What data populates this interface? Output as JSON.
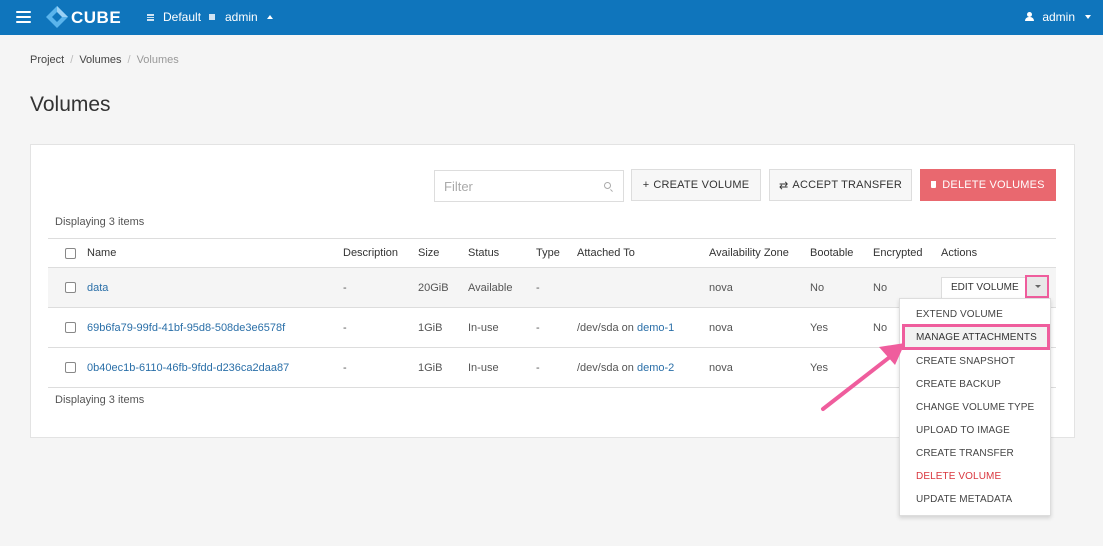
{
  "app": {
    "brand": "CUBE",
    "domain": "Default",
    "project": "admin",
    "user": "admin"
  },
  "breadcrumb": [
    "Project",
    "Volumes",
    "Volumes"
  ],
  "page_title": "Volumes",
  "toolbar": {
    "filter_placeholder": "Filter",
    "create_volume": "CREATE VOLUME",
    "accept_transfer": "ACCEPT TRANSFER",
    "delete_volumes": "DELETE VOLUMES"
  },
  "display_count": "Displaying 3 items",
  "table": {
    "headers": [
      "Name",
      "Description",
      "Size",
      "Status",
      "Type",
      "Attached To",
      "Availability Zone",
      "Bootable",
      "Encrypted",
      "Actions"
    ],
    "rows": [
      {
        "name": "data",
        "description": "-",
        "size": "20GiB",
        "status": "Available",
        "type": "-",
        "attached_path": "",
        "attached_on": "",
        "attached_instance": "",
        "zone": "nova",
        "bootable": "No",
        "encrypted": "No",
        "action": "EDIT VOLUME"
      },
      {
        "name": "69b6fa79-99fd-41bf-95d8-508de3e6578f",
        "description": "-",
        "size": "1GiB",
        "status": "In-use",
        "type": "-",
        "attached_path": "/dev/sda",
        "attached_on": "on",
        "attached_instance": "demo-1",
        "zone": "nova",
        "bootable": "Yes",
        "encrypted": "No",
        "action": ""
      },
      {
        "name": "0b40ec1b-6110-46fb-9fdd-d236ca2daa87",
        "description": "-",
        "size": "1GiB",
        "status": "In-use",
        "type": "-",
        "attached_path": "/dev/sda",
        "attached_on": "on",
        "attached_instance": "demo-2",
        "zone": "nova",
        "bootable": "Yes",
        "encrypted": "",
        "action": ""
      }
    ]
  },
  "actions_menu": [
    "EXTEND VOLUME",
    "MANAGE ATTACHMENTS",
    "CREATE SNAPSHOT",
    "CREATE BACKUP",
    "CHANGE VOLUME TYPE",
    "UPLOAD TO IMAGE",
    "CREATE TRANSFER",
    "DELETE VOLUME",
    "UPDATE METADATA"
  ],
  "colors": {
    "topbar": "#0f75bc",
    "danger_button": "#e9686f",
    "link": "#2a6fa8",
    "highlight": "#ef5d9d"
  }
}
